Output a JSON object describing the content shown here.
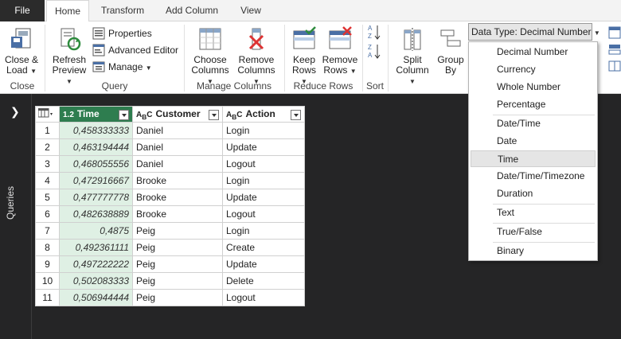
{
  "tabs": [
    "File",
    "Home",
    "Transform",
    "Add Column",
    "View"
  ],
  "active_tab": "Home",
  "ribbon": {
    "close_load": [
      "Close &",
      "Load"
    ],
    "refresh_preview": [
      "Refresh",
      "Preview"
    ],
    "properties": "Properties",
    "advanced_editor": "Advanced Editor",
    "manage": "Manage",
    "choose_columns": [
      "Choose",
      "Columns"
    ],
    "remove_columns": [
      "Remove",
      "Columns"
    ],
    "keep_rows": [
      "Keep",
      "Rows"
    ],
    "remove_rows": [
      "Remove",
      "Rows"
    ],
    "split_column": [
      "Split",
      "Column"
    ],
    "group_by": [
      "Group",
      "By"
    ],
    "data_type": "Data Type: Decimal Number",
    "groups": {
      "close": "Close",
      "query": "Query",
      "manage_columns": "Manage Columns",
      "reduce_rows": "Reduce Rows",
      "sort": "Sort"
    }
  },
  "queries_pane": {
    "label": "Queries"
  },
  "table": {
    "time_type": "1.2",
    "columns": [
      "Time",
      "Customer",
      "Action"
    ],
    "rows": [
      [
        "1",
        "0,458333333",
        "Daniel",
        "Login"
      ],
      [
        "2",
        "0,463194444",
        "Daniel",
        "Update"
      ],
      [
        "3",
        "0,468055556",
        "Daniel",
        "Logout"
      ],
      [
        "4",
        "0,472916667",
        "Brooke",
        "Login"
      ],
      [
        "5",
        "0,477777778",
        "Brooke",
        "Update"
      ],
      [
        "6",
        "0,482638889",
        "Brooke",
        "Logout"
      ],
      [
        "7",
        "0,4875",
        "Peig",
        "Login"
      ],
      [
        "8",
        "0,492361111",
        "Peig",
        "Create"
      ],
      [
        "9",
        "0,497222222",
        "Peig",
        "Update"
      ],
      [
        "10",
        "0,502083333",
        "Peig",
        "Delete"
      ],
      [
        "11",
        "0,506944444",
        "Peig",
        "Logout"
      ]
    ]
  },
  "data_type_menu": {
    "items": [
      "Decimal Number",
      "Currency",
      "Whole Number",
      "Percentage",
      "Date/Time",
      "Date",
      "Time",
      "Date/Time/Timezone",
      "Duration",
      "Text",
      "True/False",
      "Binary"
    ],
    "highlighted": "Time"
  },
  "colors": {
    "accent_green": "#2e7d4f",
    "file_tab": "#2b2b2b",
    "dark_bg": "#252526"
  }
}
